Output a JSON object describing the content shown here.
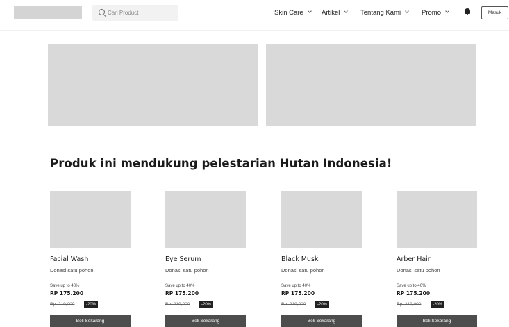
{
  "navbar": {
    "search_placeholder": "Cari Product",
    "menu": [
      {
        "label": "Skin Care"
      },
      {
        "label": "Artikel"
      },
      {
        "label": "Tentang Kami"
      },
      {
        "label": "Promo"
      }
    ],
    "login_label": "Masuk"
  },
  "section": {
    "title": "Produk ini mendukung pelestarian Hutan Indonesia!"
  },
  "products": [
    {
      "name": "Facial Wash",
      "donation": "Donasi satu pohon",
      "save": "Save up to 40%",
      "price": "RP 175.200",
      "old_price": "Rp. 219,000",
      "discount": "-20%",
      "button": "Beli Sekarang"
    },
    {
      "name": "Eye Serum",
      "donation": "Donasi satu pohon",
      "save": "Save up to 40%",
      "price": "RP 175.200",
      "old_price": "Rp. 219,000",
      "discount": "-20%",
      "button": "Beli Sekarang"
    },
    {
      "name": "Black Musk",
      "donation": "Donasi satu pohon",
      "save": "Save up to 40%",
      "price": "RP 175.200",
      "old_price": "Rp. 219,000",
      "discount": "-20%",
      "button": "Beli Sekarang"
    },
    {
      "name": "Arber Hair",
      "donation": "Donasi satu pohon",
      "save": "Save up to 40%",
      "price": "RP 175.200",
      "old_price": "Rp. 219,000",
      "discount": "-20%",
      "button": "Beli Sekarang"
    }
  ],
  "icons": {
    "search": "search-icon",
    "chevron": "chevron-down-icon",
    "bell": "bell-icon"
  },
  "colors": {
    "placeholder_gray": "#d9d9d9",
    "button_dark": "#4d4d4d",
    "badge_dark": "#222222"
  }
}
